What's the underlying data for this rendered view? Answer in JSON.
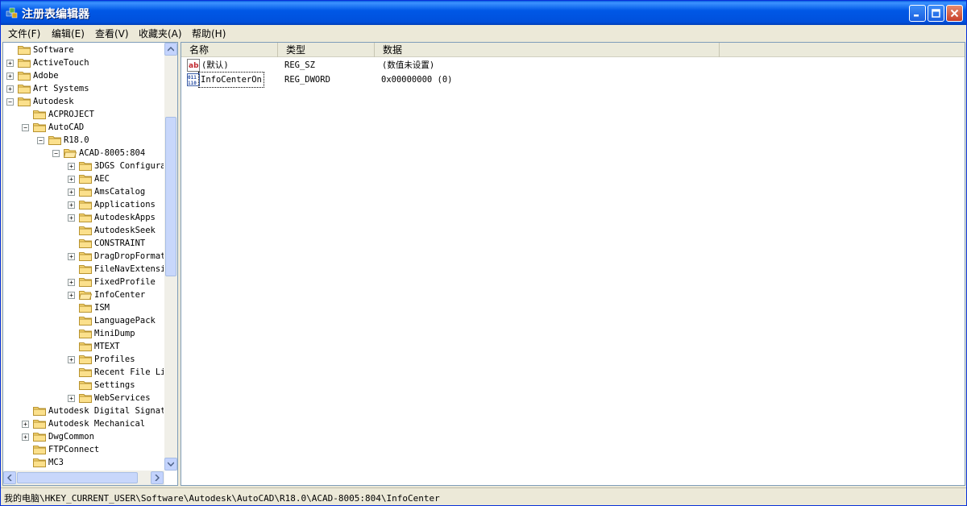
{
  "window": {
    "title": "注册表编辑器",
    "accent_color": "#0054e3"
  },
  "menu": [
    {
      "label": "文件(F)"
    },
    {
      "label": "编辑(E)"
    },
    {
      "label": "查看(V)"
    },
    {
      "label": "收藏夹(A)"
    },
    {
      "label": "帮助(H)"
    }
  ],
  "tree": [
    {
      "label": "Software",
      "level": 0,
      "expander": "none",
      "icon": "folder-icon"
    },
    {
      "label": "ActiveTouch",
      "level": 0,
      "expander": "plus",
      "icon": "folder-icon"
    },
    {
      "label": "Adobe",
      "level": 0,
      "expander": "plus",
      "icon": "folder-icon"
    },
    {
      "label": "Art Systems",
      "level": 0,
      "expander": "plus",
      "icon": "folder-icon"
    },
    {
      "label": "Autodesk",
      "level": 0,
      "expander": "minus",
      "icon": "folder-icon"
    },
    {
      "label": "ACPROJECT",
      "level": 1,
      "expander": "none",
      "icon": "folder-icon"
    },
    {
      "label": "AutoCAD",
      "level": 1,
      "expander": "minus",
      "icon": "folder-icon"
    },
    {
      "label": "R18.0",
      "level": 2,
      "expander": "minus",
      "icon": "folder-icon"
    },
    {
      "label": "ACAD-8005:804",
      "level": 3,
      "expander": "minus",
      "icon": "folder-open-icon"
    },
    {
      "label": "3DGS Configura",
      "level": 4,
      "expander": "plus",
      "icon": "folder-icon"
    },
    {
      "label": "AEC",
      "level": 4,
      "expander": "plus",
      "icon": "folder-icon"
    },
    {
      "label": "AmsCatalog",
      "level": 4,
      "expander": "plus",
      "icon": "folder-icon"
    },
    {
      "label": "Applications",
      "level": 4,
      "expander": "plus",
      "icon": "folder-icon"
    },
    {
      "label": "AutodeskApps",
      "level": 4,
      "expander": "plus",
      "icon": "folder-icon"
    },
    {
      "label": "AutodeskSeek",
      "level": 4,
      "expander": "none",
      "icon": "folder-icon"
    },
    {
      "label": "CONSTRAINT",
      "level": 4,
      "expander": "none",
      "icon": "folder-icon"
    },
    {
      "label": "DragDropFormat",
      "level": 4,
      "expander": "plus",
      "icon": "folder-icon"
    },
    {
      "label": "FileNavExtensi",
      "level": 4,
      "expander": "none",
      "icon": "folder-icon"
    },
    {
      "label": "FixedProfile",
      "level": 4,
      "expander": "plus",
      "icon": "folder-icon"
    },
    {
      "label": "InfoCenter",
      "level": 4,
      "expander": "plus",
      "icon": "folder-open-icon"
    },
    {
      "label": "ISM",
      "level": 4,
      "expander": "none",
      "icon": "folder-icon"
    },
    {
      "label": "LanguagePack",
      "level": 4,
      "expander": "none",
      "icon": "folder-icon"
    },
    {
      "label": "MiniDump",
      "level": 4,
      "expander": "none",
      "icon": "folder-icon"
    },
    {
      "label": "MTEXT",
      "level": 4,
      "expander": "none",
      "icon": "folder-icon"
    },
    {
      "label": "Profiles",
      "level": 4,
      "expander": "plus",
      "icon": "folder-icon"
    },
    {
      "label": "Recent File Li",
      "level": 4,
      "expander": "none",
      "icon": "folder-icon"
    },
    {
      "label": "Settings",
      "level": 4,
      "expander": "none",
      "icon": "folder-icon"
    },
    {
      "label": "WebServices",
      "level": 4,
      "expander": "plus",
      "icon": "folder-icon"
    },
    {
      "label": "Autodesk Digital Signatu",
      "level": 1,
      "expander": "none",
      "icon": "folder-icon"
    },
    {
      "label": "Autodesk Mechanical",
      "level": 1,
      "expander": "plus",
      "icon": "folder-icon"
    },
    {
      "label": "DwgCommon",
      "level": 1,
      "expander": "plus",
      "icon": "folder-icon"
    },
    {
      "label": "FTPConnect",
      "level": 1,
      "expander": "none",
      "icon": "folder-icon"
    },
    {
      "label": "MC3",
      "level": 1,
      "expander": "none",
      "icon": "folder-icon"
    }
  ],
  "list": {
    "columns": [
      "名称",
      "类型",
      "数据"
    ],
    "rows": [
      {
        "name": "(默认)",
        "type": "REG_SZ",
        "data": "(数值未设置)",
        "icon": "string-value-icon"
      },
      {
        "name": "InfoCenterOn",
        "type": "REG_DWORD",
        "data": "0x00000000 (0)",
        "icon": "binary-value-icon"
      }
    ]
  },
  "status": {
    "path": "我的电脑\\HKEY_CURRENT_USER\\Software\\Autodesk\\AutoCAD\\R18.0\\ACAD-8005:804\\InfoCenter"
  }
}
